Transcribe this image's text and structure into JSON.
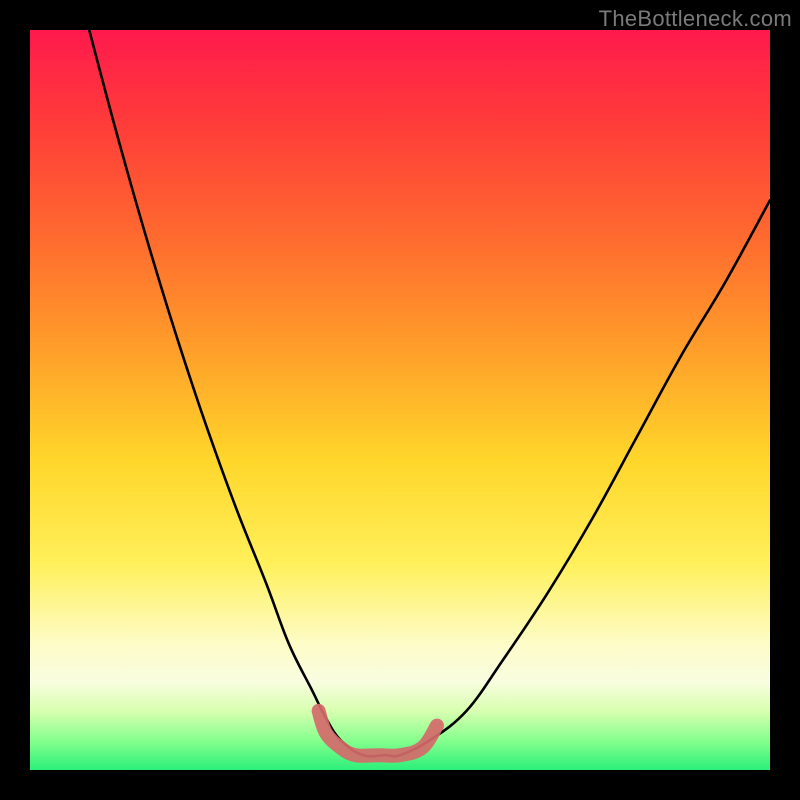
{
  "watermark": "TheBottleneck.com",
  "chart_data": {
    "type": "line",
    "title": "",
    "xlabel": "",
    "ylabel": "",
    "xlim": [
      0,
      100
    ],
    "ylim": [
      0,
      100
    ],
    "grid": false,
    "series": [
      {
        "name": "black-curve",
        "color": "#000000",
        "x": [
          8,
          12,
          16,
          20,
          24,
          28,
          32,
          35,
          38,
          40,
          42,
          45,
          48,
          50,
          54,
          59,
          64,
          70,
          76,
          82,
          88,
          94,
          100
        ],
        "y": [
          100,
          85,
          71,
          58,
          46,
          35,
          25,
          17,
          11,
          7,
          4,
          2,
          2,
          2,
          4,
          8,
          15,
          24,
          34,
          45,
          56,
          66,
          77
        ]
      },
      {
        "name": "bottom-optimal-overlay",
        "color": "#d86b6b",
        "x": [
          39,
          40,
          42,
          44,
          47,
          50,
          53,
          55
        ],
        "y": [
          8,
          5,
          3,
          2,
          2,
          2,
          3,
          6
        ]
      }
    ],
    "background_palette": {
      "top": "#ff1a4d",
      "bottom": "#2bf07a",
      "note": "vertical gradient red→orange→yellow→cream→green"
    }
  }
}
